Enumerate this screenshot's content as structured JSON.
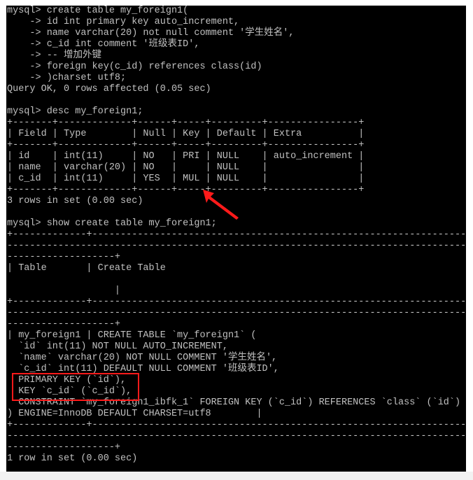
{
  "colors": {
    "terminal_bg": "#000000",
    "terminal_fg": "#c0c0c0",
    "annotation": "#ff1a1a"
  },
  "terminal": {
    "lines": [
      "mysql> create table my_foreign1(",
      "    -> id int primary key auto_increment,",
      "    -> name varchar(20) not null comment '学生姓名',",
      "    -> c_id int comment '班级表ID',",
      "    -> -- 增加外键",
      "    -> foreign key(c_id) references class(id)",
      "    -> )charset utf8;",
      "Query OK, 0 rows affected (0.05 sec)",
      "",
      "mysql> desc my_foreign1;",
      "+-------+-------------+------+-----+---------+----------------+",
      "| Field | Type        | Null | Key | Default | Extra          |",
      "+-------+-------------+------+-----+---------+----------------+",
      "| id    | int(11)     | NO   | PRI | NULL    | auto_increment |",
      "| name  | varchar(20) | NO   |     | NULL    |                |",
      "| c_id  | int(11)     | YES  | MUL | NULL    |                |",
      "+-------+-------------+------+-----+---------+----------------+",
      "3 rows in set (0.00 sec)",
      "",
      "mysql> show create table my_foreign1;",
      "+-------------+------------------------------------------------------------------",
      "---------------------------------------------------------------------------------",
      "-------------------+",
      "| Table       | Create Table",
      "",
      "                   |",
      "+-------------+------------------------------------------------------------------",
      "---------------------------------------------------------------------------------",
      "-------------------+",
      "| my_foreign1 | CREATE TABLE `my_foreign1` (",
      "  `id` int(11) NOT NULL AUTO_INCREMENT,",
      "  `name` varchar(20) NOT NULL COMMENT '学生姓名',",
      "  `c_id` int(11) DEFAULT NULL COMMENT '班级表ID',",
      "  PRIMARY KEY (`id`),",
      "  KEY `c_id` (`c_id`),",
      "  CONSTRAINT `my_foreign1_ibfk_1` FOREIGN KEY (`c_id`) REFERENCES `class` (`id`)",
      ") ENGINE=InnoDB DEFAULT CHARSET=utf8        |",
      "+-------------+------------------------------------------------------------------",
      "---------------------------------------------------------------------------------",
      "-------------------+",
      "1 row in set (0.00 sec)"
    ]
  }
}
